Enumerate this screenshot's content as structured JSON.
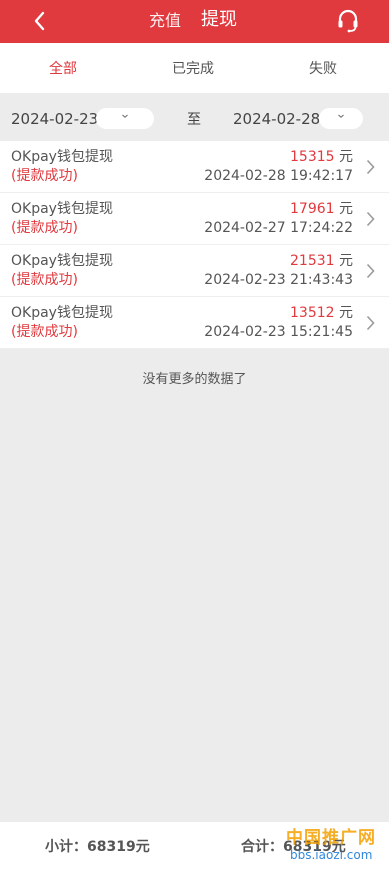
{
  "header": {
    "tab_recharge": "充值",
    "tab_withdraw": "提现",
    "back_icon": "chevron-left-icon",
    "support_icon": "headset-icon",
    "bg_color": "#e0393e"
  },
  "status_tabs": [
    "全部",
    "已完成",
    "失败"
  ],
  "active_status_tab": "全部",
  "date_filter": {
    "start": "2024-02-23",
    "separator": "至",
    "end": "2024-02-28"
  },
  "records": [
    {
      "title": "OKpay钱包提现",
      "status": "(提款成功)",
      "amount": "15315",
      "unit": "元",
      "time": "2024-02-28 19:42:17"
    },
    {
      "title": "OKpay钱包提现",
      "status": "(提款成功)",
      "amount": "17961",
      "unit": "元",
      "time": "2024-02-27 17:24:22"
    },
    {
      "title": "OKpay钱包提现",
      "status": "(提款成功)",
      "amount": "21531",
      "unit": "元",
      "time": "2024-02-23 21:43:43"
    },
    {
      "title": "OKpay钱包提现",
      "status": "(提款成功)",
      "amount": "13512",
      "unit": "元",
      "time": "2024-02-23 15:21:45"
    }
  ],
  "no_more_text": "没有更多的数据了",
  "footer": {
    "subtotal": "小计：68319元",
    "total": "合计：68319元"
  },
  "watermark": {
    "line1": "中国推广网",
    "line2": "bbs.iaozi.com"
  }
}
